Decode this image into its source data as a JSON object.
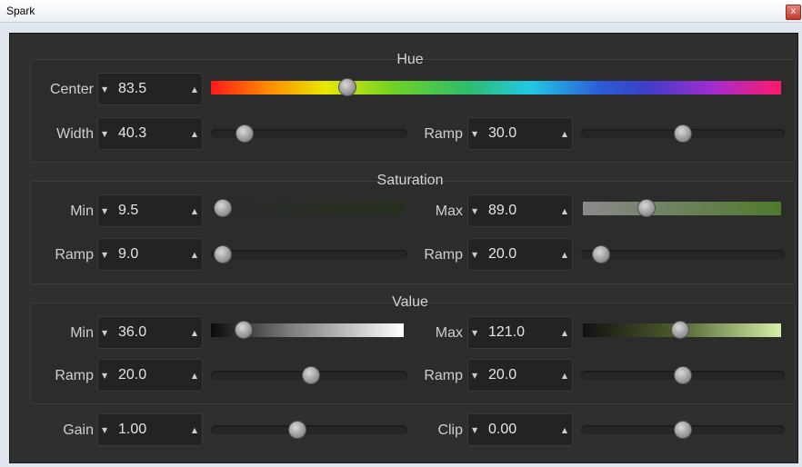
{
  "window": {
    "title": "Spark",
    "close_glyph": "x"
  },
  "glyphs": {
    "down": "▼",
    "up": "▲"
  },
  "hue": {
    "title": "Hue",
    "center": {
      "label": "Center",
      "value": "83.5",
      "level": 0.24
    },
    "width": {
      "label": "Width",
      "value": "40.3",
      "level": 0.17
    },
    "ramp": {
      "label": "Ramp",
      "value": "30.0",
      "level": 0.5
    }
  },
  "saturation": {
    "title": "Saturation",
    "min": {
      "label": "Min",
      "value": "9.5",
      "level": 0.06
    },
    "max": {
      "label": "Max",
      "value": "89.0",
      "level": 0.32
    },
    "ramp_left": {
      "label": "Ramp",
      "value": "9.0",
      "level": 0.06
    },
    "ramp_right": {
      "label": "Ramp",
      "value": "20.0",
      "level": 0.1
    }
  },
  "value": {
    "title": "Value",
    "min": {
      "label": "Min",
      "value": "36.0",
      "level": 0.17
    },
    "max": {
      "label": "Max",
      "value": "121.0",
      "level": 0.49
    },
    "ramp_left": {
      "label": "Ramp",
      "value": "20.0",
      "level": 0.51
    },
    "ramp_right": {
      "label": "Ramp",
      "value": "20.0",
      "level": 0.5
    }
  },
  "gain": {
    "label": "Gain",
    "value": "1.00",
    "level": 0.44
  },
  "clip": {
    "label": "Clip",
    "value": "0.00",
    "level": 0.5
  },
  "colors": {
    "panel_bg": "#2f2f2f",
    "sat_max_gradient_end": "#4e7a2b",
    "value_max_gradient_end": "#d6f0a8"
  }
}
